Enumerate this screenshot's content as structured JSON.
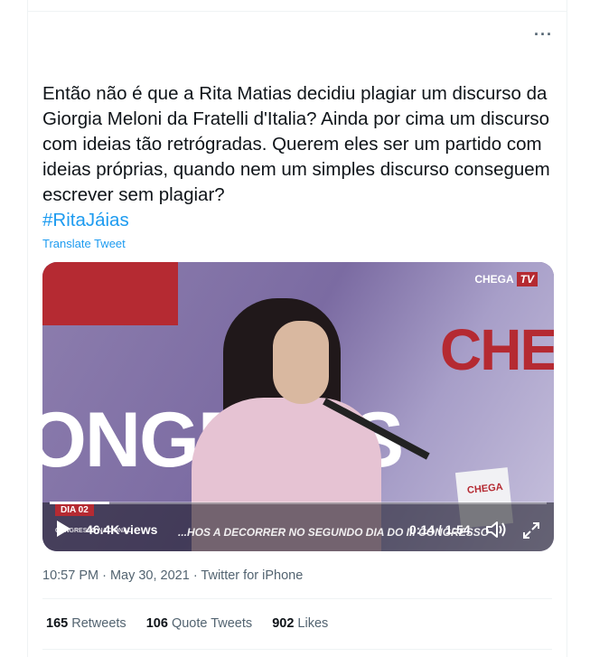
{
  "tweet": {
    "text": "Então não é que a Rita Matias decidiu plagiar um discurso da Giorgia Meloni da Fratelli d'Italia? Ainda por cima um discurso com ideias tão retrógradas. Querem eles ser um partido com ideias próprias, quando nem um simples discurso conseguem escrever sem plagiar?",
    "hashtag": "#RitaJáias",
    "translate_label": "Translate Tweet",
    "timestamp": "10:57 PM · May 30, 2021 · Twitter for iPhone"
  },
  "video": {
    "views": "46.4K views",
    "time": "0:14 / 1:54",
    "progress": 0.12,
    "channel_logo_text": "CHEGA",
    "channel_logo_tv": "TV",
    "day_badge": "DIA 02",
    "ticker_text": "...HOS A DECORRER NO SEGUNDO DIA DO III CONGRESSO",
    "congresso_label": "CONGRESSO NACIONAL",
    "backdrop_text_1": "CHE",
    "backdrop_text_2": "ONGRESS",
    "podium_label": "CHEGA"
  },
  "stats": {
    "retweets": {
      "count": "165",
      "label": "Retweets"
    },
    "quote_tweets": {
      "count": "106",
      "label": "Quote Tweets"
    },
    "likes": {
      "count": "902",
      "label": "Likes"
    }
  },
  "colors": {
    "link": "#1d9bf0",
    "muted": "#536471",
    "brand_red": "#b52a32"
  },
  "icons": [
    "more-icon",
    "play-icon",
    "volume-icon",
    "fullscreen-icon"
  ]
}
